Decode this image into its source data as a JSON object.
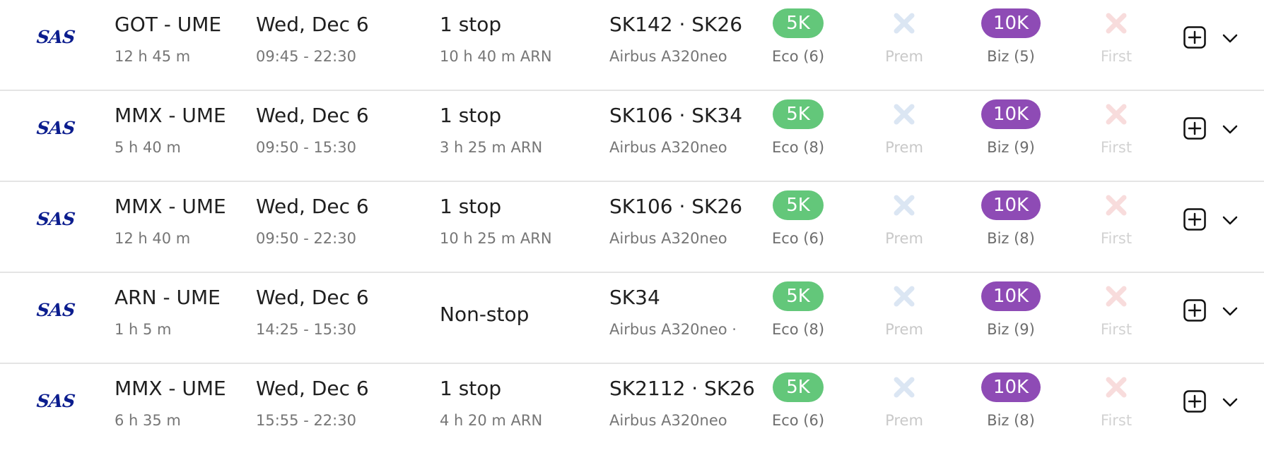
{
  "colors": {
    "eco_badge": "#63c77a",
    "biz_badge": "#8e4bb5",
    "prem_unavailable": "#dbe6f3",
    "first_unavailable": "#f8dcdc",
    "brand": "#0b1d8e"
  },
  "icons": {
    "unavailable": "x-icon",
    "add": "plus-square-icon",
    "expand": "chevron-down-icon"
  },
  "results": [
    {
      "airline": "SAS",
      "route": "GOT - UME",
      "duration": "12 h 45 m",
      "date": "Wed, Dec 6",
      "times": "09:45 - 22:30",
      "stops": "1 stop",
      "layover": "10 h 40 m  ARN",
      "flights": "SK142  ·  SK26",
      "aircraft": "Airbus A320neo",
      "eco_cost": "5K",
      "eco_label": "Eco (6)",
      "prem_label": "Prem",
      "biz_cost": "10K",
      "biz_label": "Biz (5)",
      "first_label": "First"
    },
    {
      "airline": "SAS",
      "route": "MMX - UME",
      "duration": "5 h 40 m",
      "date": "Wed, Dec 6",
      "times": "09:50 - 15:30",
      "stops": "1 stop",
      "layover": "3 h 25 m  ARN",
      "flights": "SK106  ·  SK34",
      "aircraft": "Airbus A320neo",
      "eco_cost": "5K",
      "eco_label": "Eco (8)",
      "prem_label": "Prem",
      "biz_cost": "10K",
      "biz_label": "Biz (9)",
      "first_label": "First"
    },
    {
      "airline": "SAS",
      "route": "MMX - UME",
      "duration": "12 h 40 m",
      "date": "Wed, Dec 6",
      "times": "09:50 - 22:30",
      "stops": "1 stop",
      "layover": "10 h 25 m  ARN",
      "flights": "SK106  ·  SK26",
      "aircraft": "Airbus A320neo",
      "eco_cost": "5K",
      "eco_label": "Eco (6)",
      "prem_label": "Prem",
      "biz_cost": "10K",
      "biz_label": "Biz (8)",
      "first_label": "First"
    },
    {
      "airline": "SAS",
      "route": "ARN - UME",
      "duration": "1 h 5 m",
      "date": "Wed, Dec 6",
      "times": "14:25 - 15:30",
      "stops": "Non-stop",
      "layover": "",
      "flights": "SK34",
      "aircraft": "Airbus A320neo  ·",
      "eco_cost": "5K",
      "eco_label": "Eco (8)",
      "prem_label": "Prem",
      "biz_cost": "10K",
      "biz_label": "Biz (9)",
      "first_label": "First"
    },
    {
      "airline": "SAS",
      "route": "MMX - UME",
      "duration": "6 h 35 m",
      "date": "Wed, Dec 6",
      "times": "15:55 - 22:30",
      "stops": "1 stop",
      "layover": "4 h 20 m  ARN",
      "flights": "SK2112  ·  SK26",
      "aircraft": "Airbus A320neo",
      "eco_cost": "5K",
      "eco_label": "Eco (6)",
      "prem_label": "Prem",
      "biz_cost": "10K",
      "biz_label": "Biz (8)",
      "first_label": "First"
    }
  ]
}
